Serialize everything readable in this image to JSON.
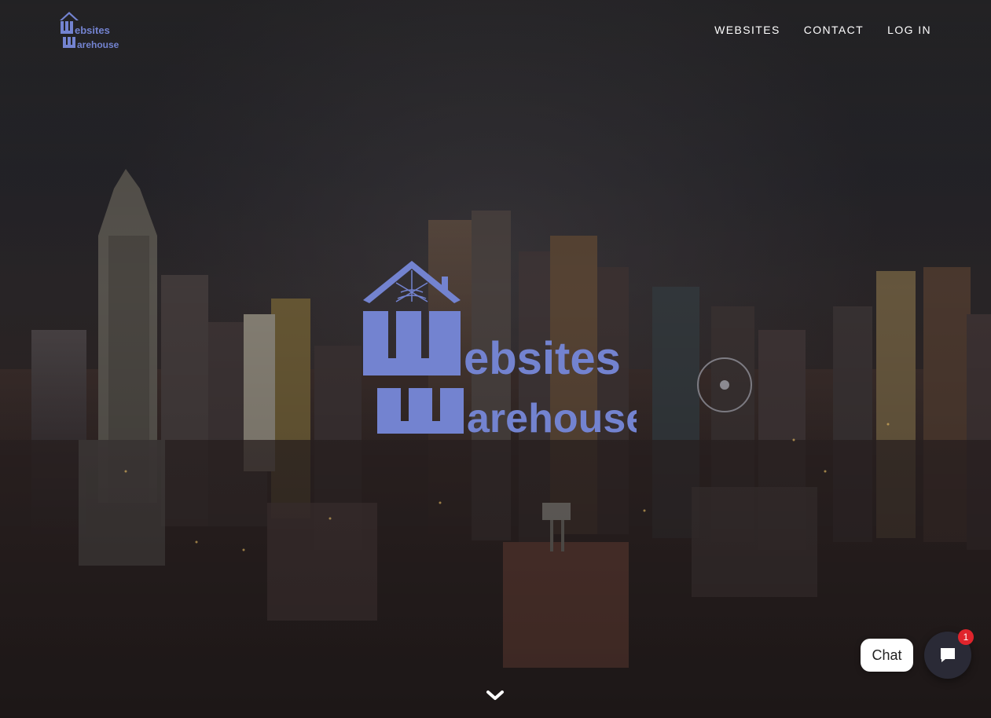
{
  "site": {
    "logo_alt": "Websites Warehouse",
    "brand_color": "#7383d0"
  },
  "nav": {
    "links": [
      {
        "label": "WEBSITES"
      },
      {
        "label": "CONTACT"
      },
      {
        "label": "LOG IN"
      }
    ]
  },
  "hero": {
    "logo_line1": "ebsites",
    "logo_line2": "arehouse",
    "scroll_icon": "chevron-down-icon"
  },
  "chat": {
    "label": "Chat",
    "badge_count": "1",
    "icon": "chat-icon"
  }
}
